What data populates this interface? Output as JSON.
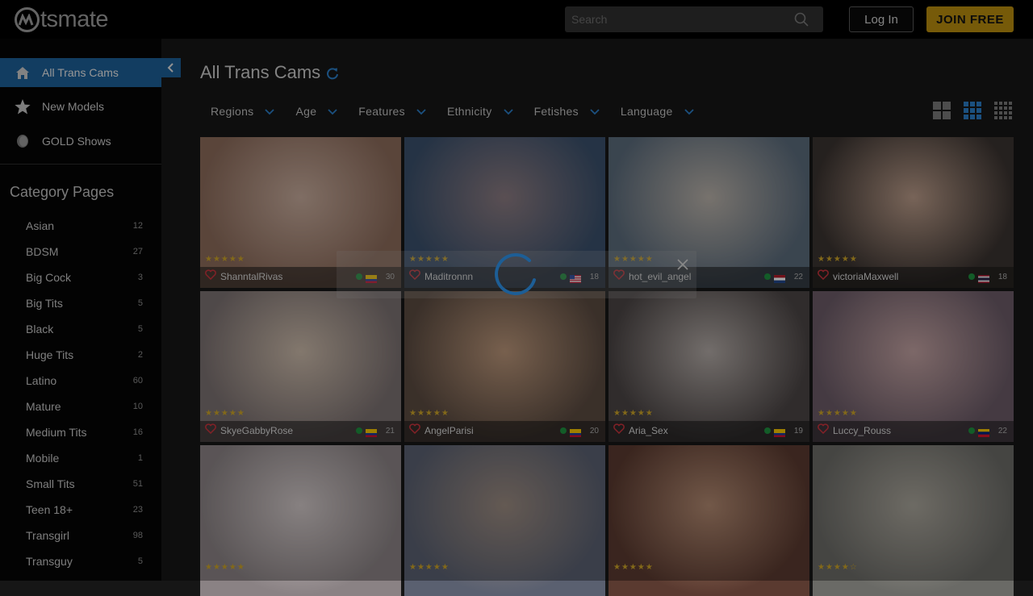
{
  "header": {
    "logo_text": "tsmate",
    "search_placeholder": "Search",
    "login_label": "Log In",
    "join_label": "JOIN FREE",
    "colors": {
      "background": "#000000",
      "join": "#b58a0e",
      "accent": "#1d5e96"
    }
  },
  "sidebar": {
    "nav": [
      {
        "label": "All Trans Cams",
        "icon": "home-icon",
        "active": true
      },
      {
        "label": "New Models",
        "icon": "star-icon",
        "active": false
      },
      {
        "label": "GOLD Shows",
        "icon": "gold-coin-icon",
        "active": false
      }
    ],
    "category_title": "Category Pages",
    "categories": [
      {
        "label": "Asian",
        "count": "12"
      },
      {
        "label": "BDSM",
        "count": "27"
      },
      {
        "label": "Big Cock",
        "count": "3"
      },
      {
        "label": "Big Tits",
        "count": "5"
      },
      {
        "label": "Black",
        "count": "5"
      },
      {
        "label": "Huge Tits",
        "count": "2"
      },
      {
        "label": "Latino",
        "count": "60"
      },
      {
        "label": "Mature",
        "count": "10"
      },
      {
        "label": "Medium Tits",
        "count": "16"
      },
      {
        "label": "Mobile",
        "count": "1"
      },
      {
        "label": "Small Tits",
        "count": "51"
      },
      {
        "label": "Teen 18+",
        "count": "23"
      },
      {
        "label": "Transgirl",
        "count": "98"
      },
      {
        "label": "Transguy",
        "count": "5"
      }
    ]
  },
  "main": {
    "title": "All Trans Cams",
    "filters": [
      "Regions",
      "Age",
      "Features",
      "Ethnicity",
      "Fetishes",
      "Language"
    ],
    "view_modes": [
      "large-grid-icon",
      "medium-grid-icon",
      "small-grid-icon"
    ],
    "models": [
      {
        "name": "ShanntalRivas",
        "age": "30",
        "flag": "colombia",
        "stars": "★★★★★",
        "tone": [
          "#8a6a5a",
          "#c4a99a"
        ]
      },
      {
        "name": "Maditronnn",
        "age": "18",
        "flag": "usa",
        "stars": "★★★★★",
        "tone": [
          "#3a4f6a",
          "#8a7a80"
        ]
      },
      {
        "name": "hot_evil_angel",
        "age": "22",
        "flag": "netherlands",
        "stars": "★★★★★",
        "tone": [
          "#5a6a7a",
          "#b7b0a8"
        ]
      },
      {
        "name": "victoriaMaxwell",
        "age": "18",
        "flag": "thailand",
        "stars": "★★★★★",
        "tone": [
          "#3a3330",
          "#b89a88"
        ]
      },
      {
        "name": "SkyeGabbyRose",
        "age": "21",
        "flag": "colombia",
        "stars": "★★★★★",
        "tone": [
          "#7a7070",
          "#c9b8a8"
        ]
      },
      {
        "name": "AngelParisi",
        "age": "20",
        "flag": "colombia",
        "stars": "★★★★★",
        "tone": [
          "#5a4a40",
          "#b89478"
        ]
      },
      {
        "name": "Aria_Sex",
        "age": "19",
        "flag": "colombia",
        "stars": "★★★★★",
        "tone": [
          "#4a4444",
          "#b0a8a4"
        ]
      },
      {
        "name": "Luccy_Rouss",
        "age": "22",
        "flag": "venezuela",
        "stars": "★★★★★",
        "tone": [
          "#6a5a66",
          "#c0a0a0"
        ]
      },
      {
        "name": "",
        "age": "",
        "flag": "",
        "stars": "★★★★★",
        "tone": [
          "#8a8284",
          "#cfc6c6"
        ]
      },
      {
        "name": "",
        "age": "",
        "flag": "",
        "stars": "★★★★★",
        "tone": [
          "#5a6070",
          "#9a8a80"
        ]
      },
      {
        "name": "",
        "age": "",
        "flag": "",
        "stars": "★★★★★",
        "tone": [
          "#5a3a30",
          "#b08870"
        ]
      },
      {
        "name": "",
        "age": "",
        "flag": "",
        "stars": "★★★★☆",
        "tone": [
          "#6a6a66",
          "#a8a49a"
        ]
      }
    ]
  }
}
